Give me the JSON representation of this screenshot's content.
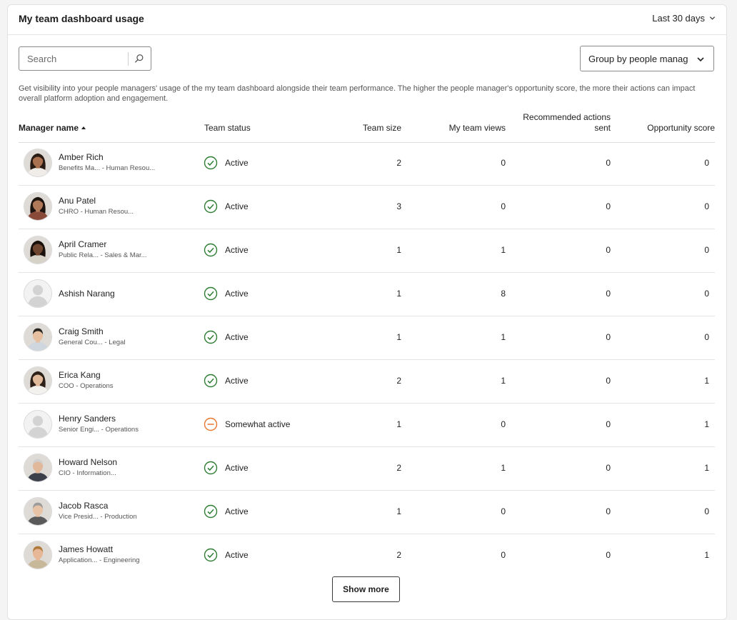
{
  "header": {
    "title": "My team dashboard usage",
    "period": "Last 30 days"
  },
  "search": {
    "placeholder": "Search"
  },
  "group_by": {
    "label": "Group by people manager"
  },
  "description": "Get visibility into your people managers' usage of the my team dashboard alongside their team performance. The higher the people manager's opportunity score, the more their actions can impact overall platform adoption and engagement.",
  "columns": {
    "manager_name": "Manager name",
    "team_status": "Team status",
    "team_size": "Team size",
    "my_team_views": "My team views",
    "recommended_actions_line1": "Recommended actions",
    "recommended_actions_line2": "sent",
    "opportunity_score": "Opportunity score"
  },
  "rows": [
    {
      "name": "Amber Rich",
      "subtitle": "Benefits Ma... - Human Resou...",
      "status": "Active",
      "team_size": "2",
      "views": "0",
      "recommended": "0",
      "opportunity": "0",
      "avatar": "photo-woman-1"
    },
    {
      "name": "Anu Patel",
      "subtitle": "CHRO - Human Resou...",
      "status": "Active",
      "team_size": "3",
      "views": "0",
      "recommended": "0",
      "opportunity": "0",
      "avatar": "photo-woman-2"
    },
    {
      "name": "April Cramer",
      "subtitle": "Public Rela... - Sales & Mar...",
      "status": "Active",
      "team_size": "1",
      "views": "1",
      "recommended": "0",
      "opportunity": "0",
      "avatar": "photo-woman-3"
    },
    {
      "name": "Ashish Narang",
      "subtitle": "",
      "status": "Active",
      "team_size": "1",
      "views": "8",
      "recommended": "0",
      "opportunity": "0",
      "avatar": "placeholder"
    },
    {
      "name": "Craig Smith",
      "subtitle": "General Cou... - Legal",
      "status": "Active",
      "team_size": "1",
      "views": "1",
      "recommended": "0",
      "opportunity": "0",
      "avatar": "photo-man-1"
    },
    {
      "name": "Erica Kang",
      "subtitle": "COO - Operations",
      "status": "Active",
      "team_size": "2",
      "views": "1",
      "recommended": "0",
      "opportunity": "1",
      "avatar": "photo-woman-4"
    },
    {
      "name": "Henry Sanders",
      "subtitle": "Senior Engi... - Operations",
      "status": "Somewhat active",
      "team_size": "1",
      "views": "0",
      "recommended": "0",
      "opportunity": "1",
      "avatar": "placeholder"
    },
    {
      "name": "Howard Nelson",
      "subtitle": "CIO - Information...",
      "status": "Active",
      "team_size": "2",
      "views": "1",
      "recommended": "0",
      "opportunity": "1",
      "avatar": "photo-man-2"
    },
    {
      "name": "Jacob Rasca",
      "subtitle": "Vice Presid... - Production",
      "status": "Active",
      "team_size": "1",
      "views": "0",
      "recommended": "0",
      "opportunity": "0",
      "avatar": "photo-man-3"
    },
    {
      "name": "James Howatt",
      "subtitle": "Application... - Engineering",
      "status": "Active",
      "team_size": "2",
      "views": "0",
      "recommended": "0",
      "opportunity": "1",
      "avatar": "photo-man-4"
    }
  ],
  "show_more_label": "Show more",
  "colors": {
    "active": "#2e7d32",
    "somewhat_active": "#e8772e",
    "text": "#1f1f1f",
    "muted": "#555555"
  }
}
